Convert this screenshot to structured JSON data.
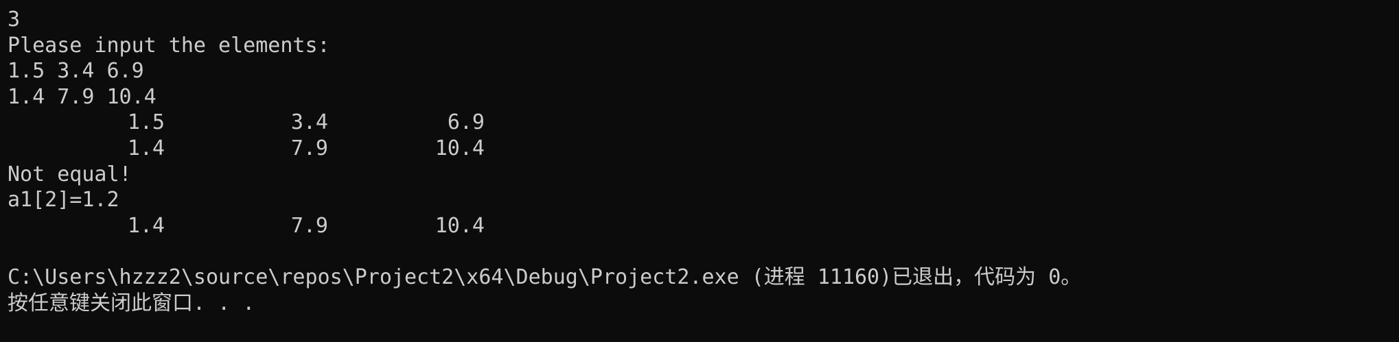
{
  "console": {
    "lines": {
      "count_echo": "3",
      "prompt": "Please input the elements:",
      "input_row1": "1.5 3.4 6.9",
      "input_row2": "1.4 7.9 10.4",
      "comparison": "Not equal!",
      "assignment": "a1[2]=1.2",
      "exit_message": "C:\\Users\\hzzz2\\source\\repos\\Project2\\x64\\Debug\\Project2.exe (进程 11160)已退出，代码为 0。",
      "press_key": "按任意键关闭此窗口. . ."
    },
    "table1": [
      [
        "1.5",
        "3.4",
        "6.9"
      ],
      [
        "1.4",
        "7.9",
        "10.4"
      ]
    ],
    "table2": [
      [
        "1.4",
        "7.9",
        "10.4"
      ]
    ]
  }
}
